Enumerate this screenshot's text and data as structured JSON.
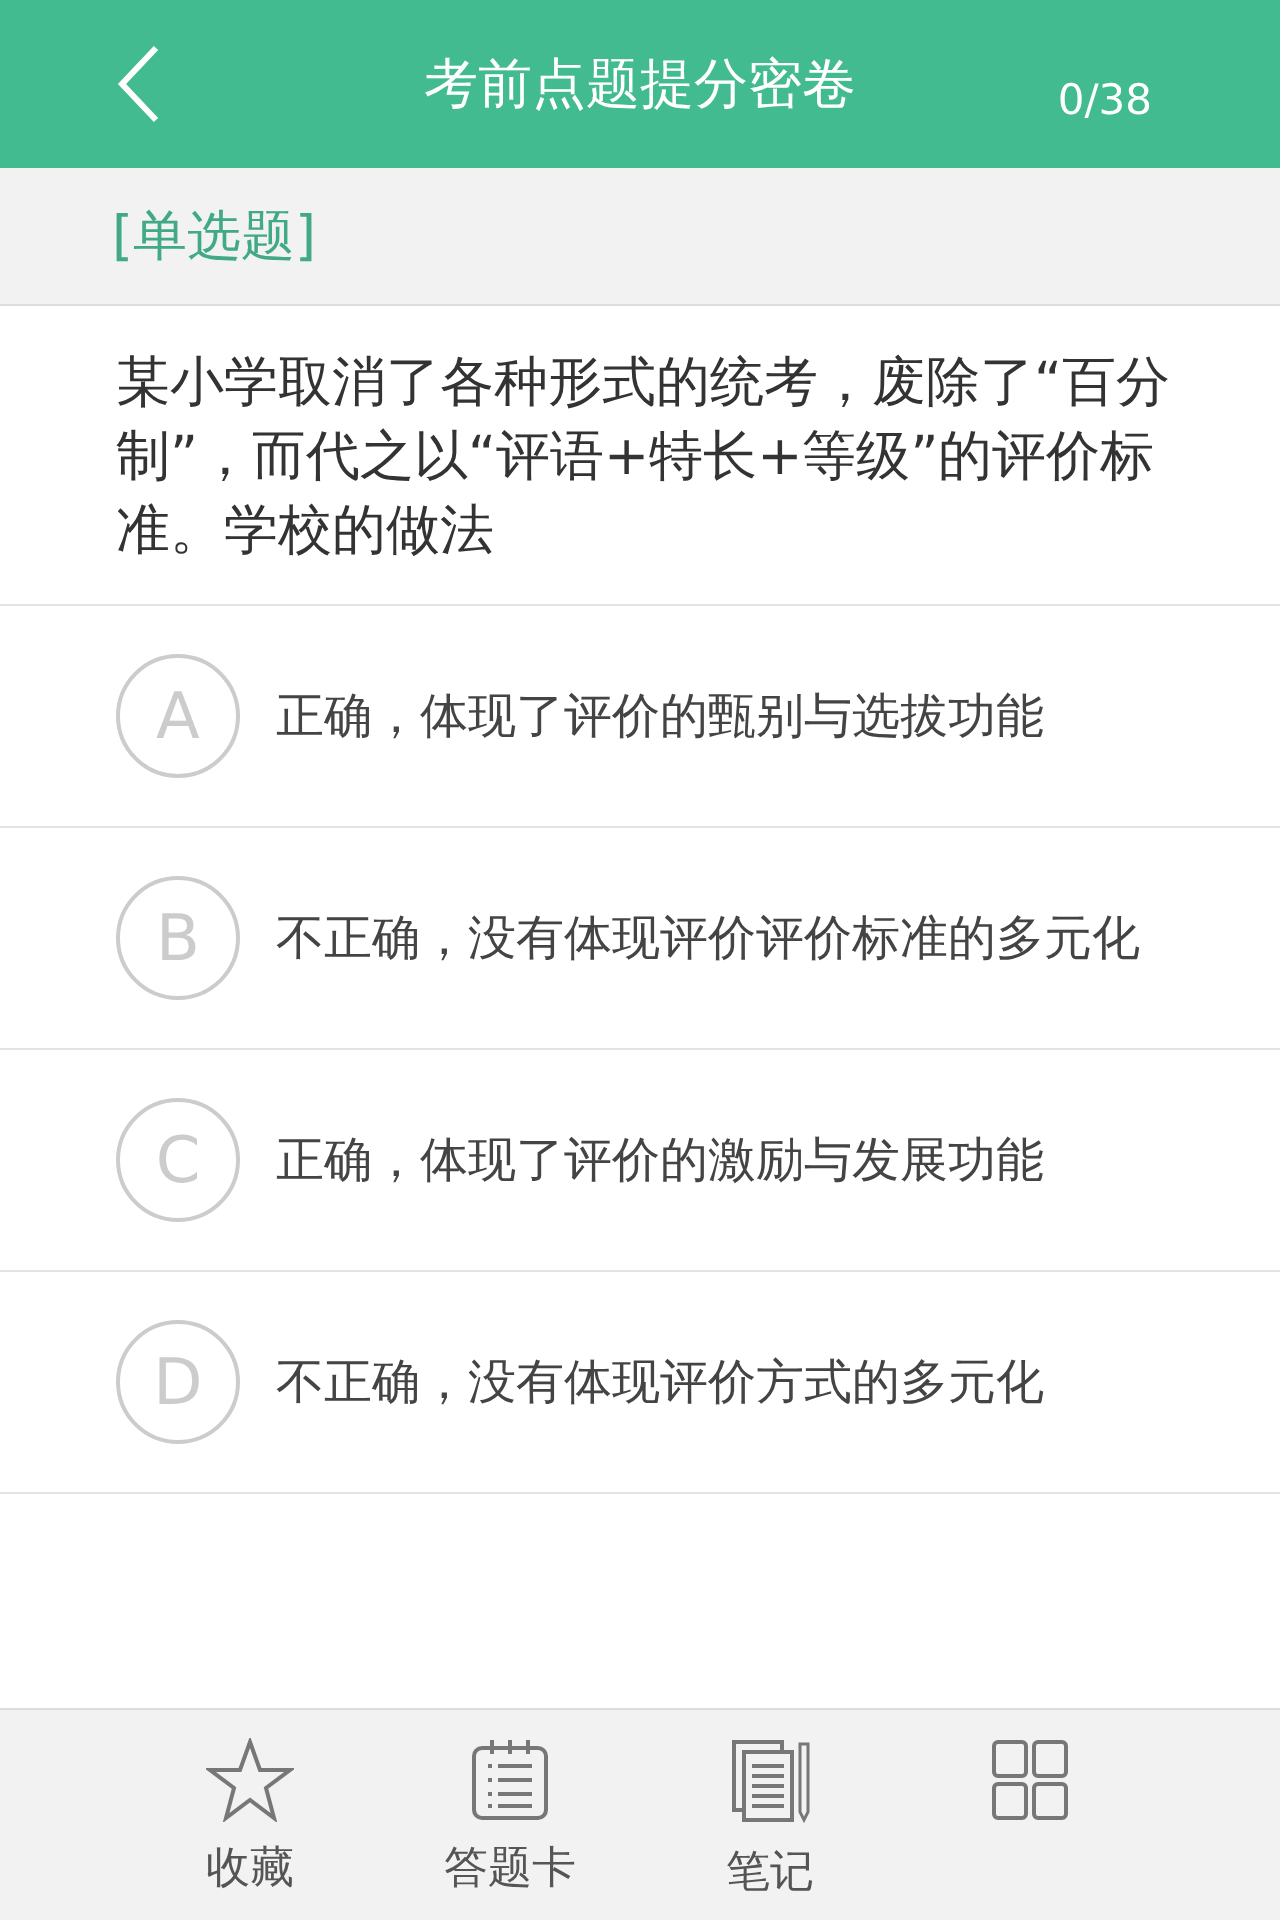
{
  "header": {
    "title": "考前点题提分密卷",
    "progress": "0/38"
  },
  "question_type": "[单选题]",
  "question": "某小学取消了各种形式的统考，废除了“百分制”，而代之以“评语+特长+等级”的评价标准。学校的做法",
  "options": [
    {
      "letter": "A",
      "text": "正确，体现了评价的甄别与选拔功能",
      "selected": false
    },
    {
      "letter": "B",
      "text": "不正确，没有体现评价评价标准的多元化",
      "selected": false
    },
    {
      "letter": "C",
      "text": "正确，体现了评价的激励与发展功能",
      "selected": false
    },
    {
      "letter": "D",
      "text": "不正确，没有体现评价方式的多元化",
      "selected": false
    }
  ],
  "toolbar": [
    {
      "kind": "star",
      "label": "收藏"
    },
    {
      "kind": "card",
      "label": "答题卡"
    },
    {
      "kind": "notes",
      "label": "笔记"
    },
    {
      "kind": "grid"
    }
  ]
}
